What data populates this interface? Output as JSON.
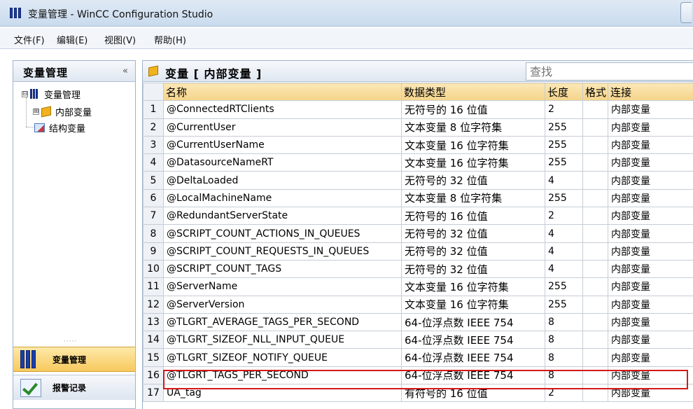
{
  "window": {
    "title": "变量管理 - WinCC Configuration Studio"
  },
  "menubar": {
    "items": [
      "文件(F)",
      "编辑(E)",
      "视图(V)",
      "帮助(H)"
    ]
  },
  "left_panel": {
    "title": "变量管理",
    "collapse_glyph": "«",
    "tree": {
      "root": "变量管理",
      "child_internal": "内部变量",
      "child_struct": "结构变量",
      "root_expander": "⊟",
      "child_expander": "⊞"
    },
    "grip": "·····",
    "nav": {
      "tag_management": "变量管理",
      "alarm_logging": "报警记录"
    }
  },
  "right_panel": {
    "title": "变量 [ 内部变量 ]",
    "search_placeholder": "查找",
    "columns": {
      "name": "名称",
      "data_type": "数据类型",
      "length": "长度",
      "format": "格式",
      "connection": "连接"
    },
    "rows": [
      {
        "num": "1",
        "name": "@ConnectedRTClients",
        "data_type": "无符号的 16 位值",
        "length": "2",
        "format": "",
        "connection": "内部变量"
      },
      {
        "num": "2",
        "name": "@CurrentUser",
        "data_type": "文本变量 8 位字符集",
        "length": "255",
        "format": "",
        "connection": "内部变量"
      },
      {
        "num": "3",
        "name": "@CurrentUserName",
        "data_type": "文本变量 16 位字符集",
        "length": "255",
        "format": "",
        "connection": "内部变量"
      },
      {
        "num": "4",
        "name": "@DatasourceNameRT",
        "data_type": "文本变量 16 位字符集",
        "length": "255",
        "format": "",
        "connection": "内部变量"
      },
      {
        "num": "5",
        "name": "@DeltaLoaded",
        "data_type": "无符号的 32 位值",
        "length": "4",
        "format": "",
        "connection": "内部变量"
      },
      {
        "num": "6",
        "name": "@LocalMachineName",
        "data_type": "文本变量 8 位字符集",
        "length": "255",
        "format": "",
        "connection": "内部变量"
      },
      {
        "num": "7",
        "name": "@RedundantServerState",
        "data_type": "无符号的 16 位值",
        "length": "2",
        "format": "",
        "connection": "内部变量"
      },
      {
        "num": "8",
        "name": "@SCRIPT_COUNT_ACTIONS_IN_QUEUES",
        "data_type": "无符号的 32 位值",
        "length": "4",
        "format": "",
        "connection": "内部变量"
      },
      {
        "num": "9",
        "name": "@SCRIPT_COUNT_REQUESTS_IN_QUEUES",
        "data_type": "无符号的 32 位值",
        "length": "4",
        "format": "",
        "connection": "内部变量"
      },
      {
        "num": "10",
        "name": "@SCRIPT_COUNT_TAGS",
        "data_type": "无符号的 32 位值",
        "length": "4",
        "format": "",
        "connection": "内部变量"
      },
      {
        "num": "11",
        "name": "@ServerName",
        "data_type": "文本变量 16 位字符集",
        "length": "255",
        "format": "",
        "connection": "内部变量"
      },
      {
        "num": "12",
        "name": "@ServerVersion",
        "data_type": "文本变量 16 位字符集",
        "length": "255",
        "format": "",
        "connection": "内部变量"
      },
      {
        "num": "13",
        "name": "@TLGRT_AVERAGE_TAGS_PER_SECOND",
        "data_type": "64-位浮点数 IEEE 754",
        "length": "8",
        "format": "",
        "connection": "内部变量"
      },
      {
        "num": "14",
        "name": "@TLGRT_SIZEOF_NLL_INPUT_QUEUE",
        "data_type": "64-位浮点数 IEEE 754",
        "length": "8",
        "format": "",
        "connection": "内部变量"
      },
      {
        "num": "15",
        "name": "@TLGRT_SIZEOF_NOTIFY_QUEUE",
        "data_type": "64-位浮点数 IEEE 754",
        "length": "8",
        "format": "",
        "connection": "内部变量"
      },
      {
        "num": "16",
        "name": "@TLGRT_TAGS_PER_SECOND",
        "data_type": "64-位浮点数 IEEE 754",
        "length": "8",
        "format": "",
        "connection": "内部变量"
      },
      {
        "num": "17",
        "name": "UA_tag",
        "data_type": "有符号的 16 位值",
        "length": "2",
        "format": "",
        "connection": "内部变量"
      }
    ],
    "highlighted_row": "17"
  },
  "colors": {
    "header_gold": "#f5d48a",
    "nav_active": "#f8c95e",
    "highlight_red": "#d31919",
    "app_icon_blue": "#1b3fa8"
  }
}
